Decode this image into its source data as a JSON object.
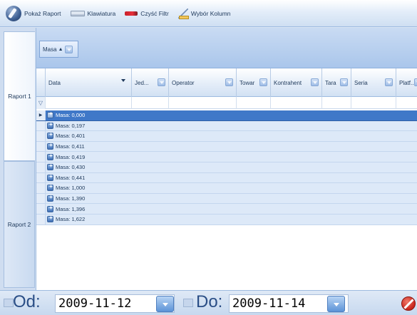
{
  "toolbar": {
    "show_report_label": "Pokaż Raport",
    "keyboard_label": "Klawiatura",
    "clear_filter_label": "Czyść Filtr",
    "column_chooser_label": "Wybór Kolumn"
  },
  "reports": {
    "tab1": "Raport 1",
    "tab2": "Raport 2"
  },
  "grid": {
    "group_by": {
      "label": "Masa",
      "sort": "ascending"
    },
    "columns": [
      {
        "label": "Data",
        "sorted": "descending"
      },
      {
        "label": "Jed..."
      },
      {
        "label": "Operator"
      },
      {
        "label": "Towar"
      },
      {
        "label": "Kontrahent"
      },
      {
        "label": "Tara"
      },
      {
        "label": "Seria"
      },
      {
        "label": "Platf..."
      }
    ],
    "groups": [
      "Masa: 0,000",
      "Masa: 0,197",
      "Masa: 0,401",
      "Masa: 0,411",
      "Masa: 0,419",
      "Masa: 0,430",
      "Masa: 0,441",
      "Masa: 1,000",
      "Masa: 1,390",
      "Masa: 1,396",
      "Masa: 1,622"
    ],
    "selected_index": 0
  },
  "date_range": {
    "from_label": "Od:",
    "from_value": "2009-11-12",
    "to_label": "Do:",
    "to_value": "2009-11-14"
  },
  "icons": {
    "show_report": "report-icon",
    "keyboard": "keyboard-icon",
    "clear_filter": "eraser-icon",
    "column_chooser": "columns-icon",
    "close": "cancel-icon"
  },
  "colors": {
    "selected_row": "#3f78c8",
    "row_background": "#dde9f8",
    "header_group": "#aac6eb",
    "accent": "#2a4e86"
  }
}
